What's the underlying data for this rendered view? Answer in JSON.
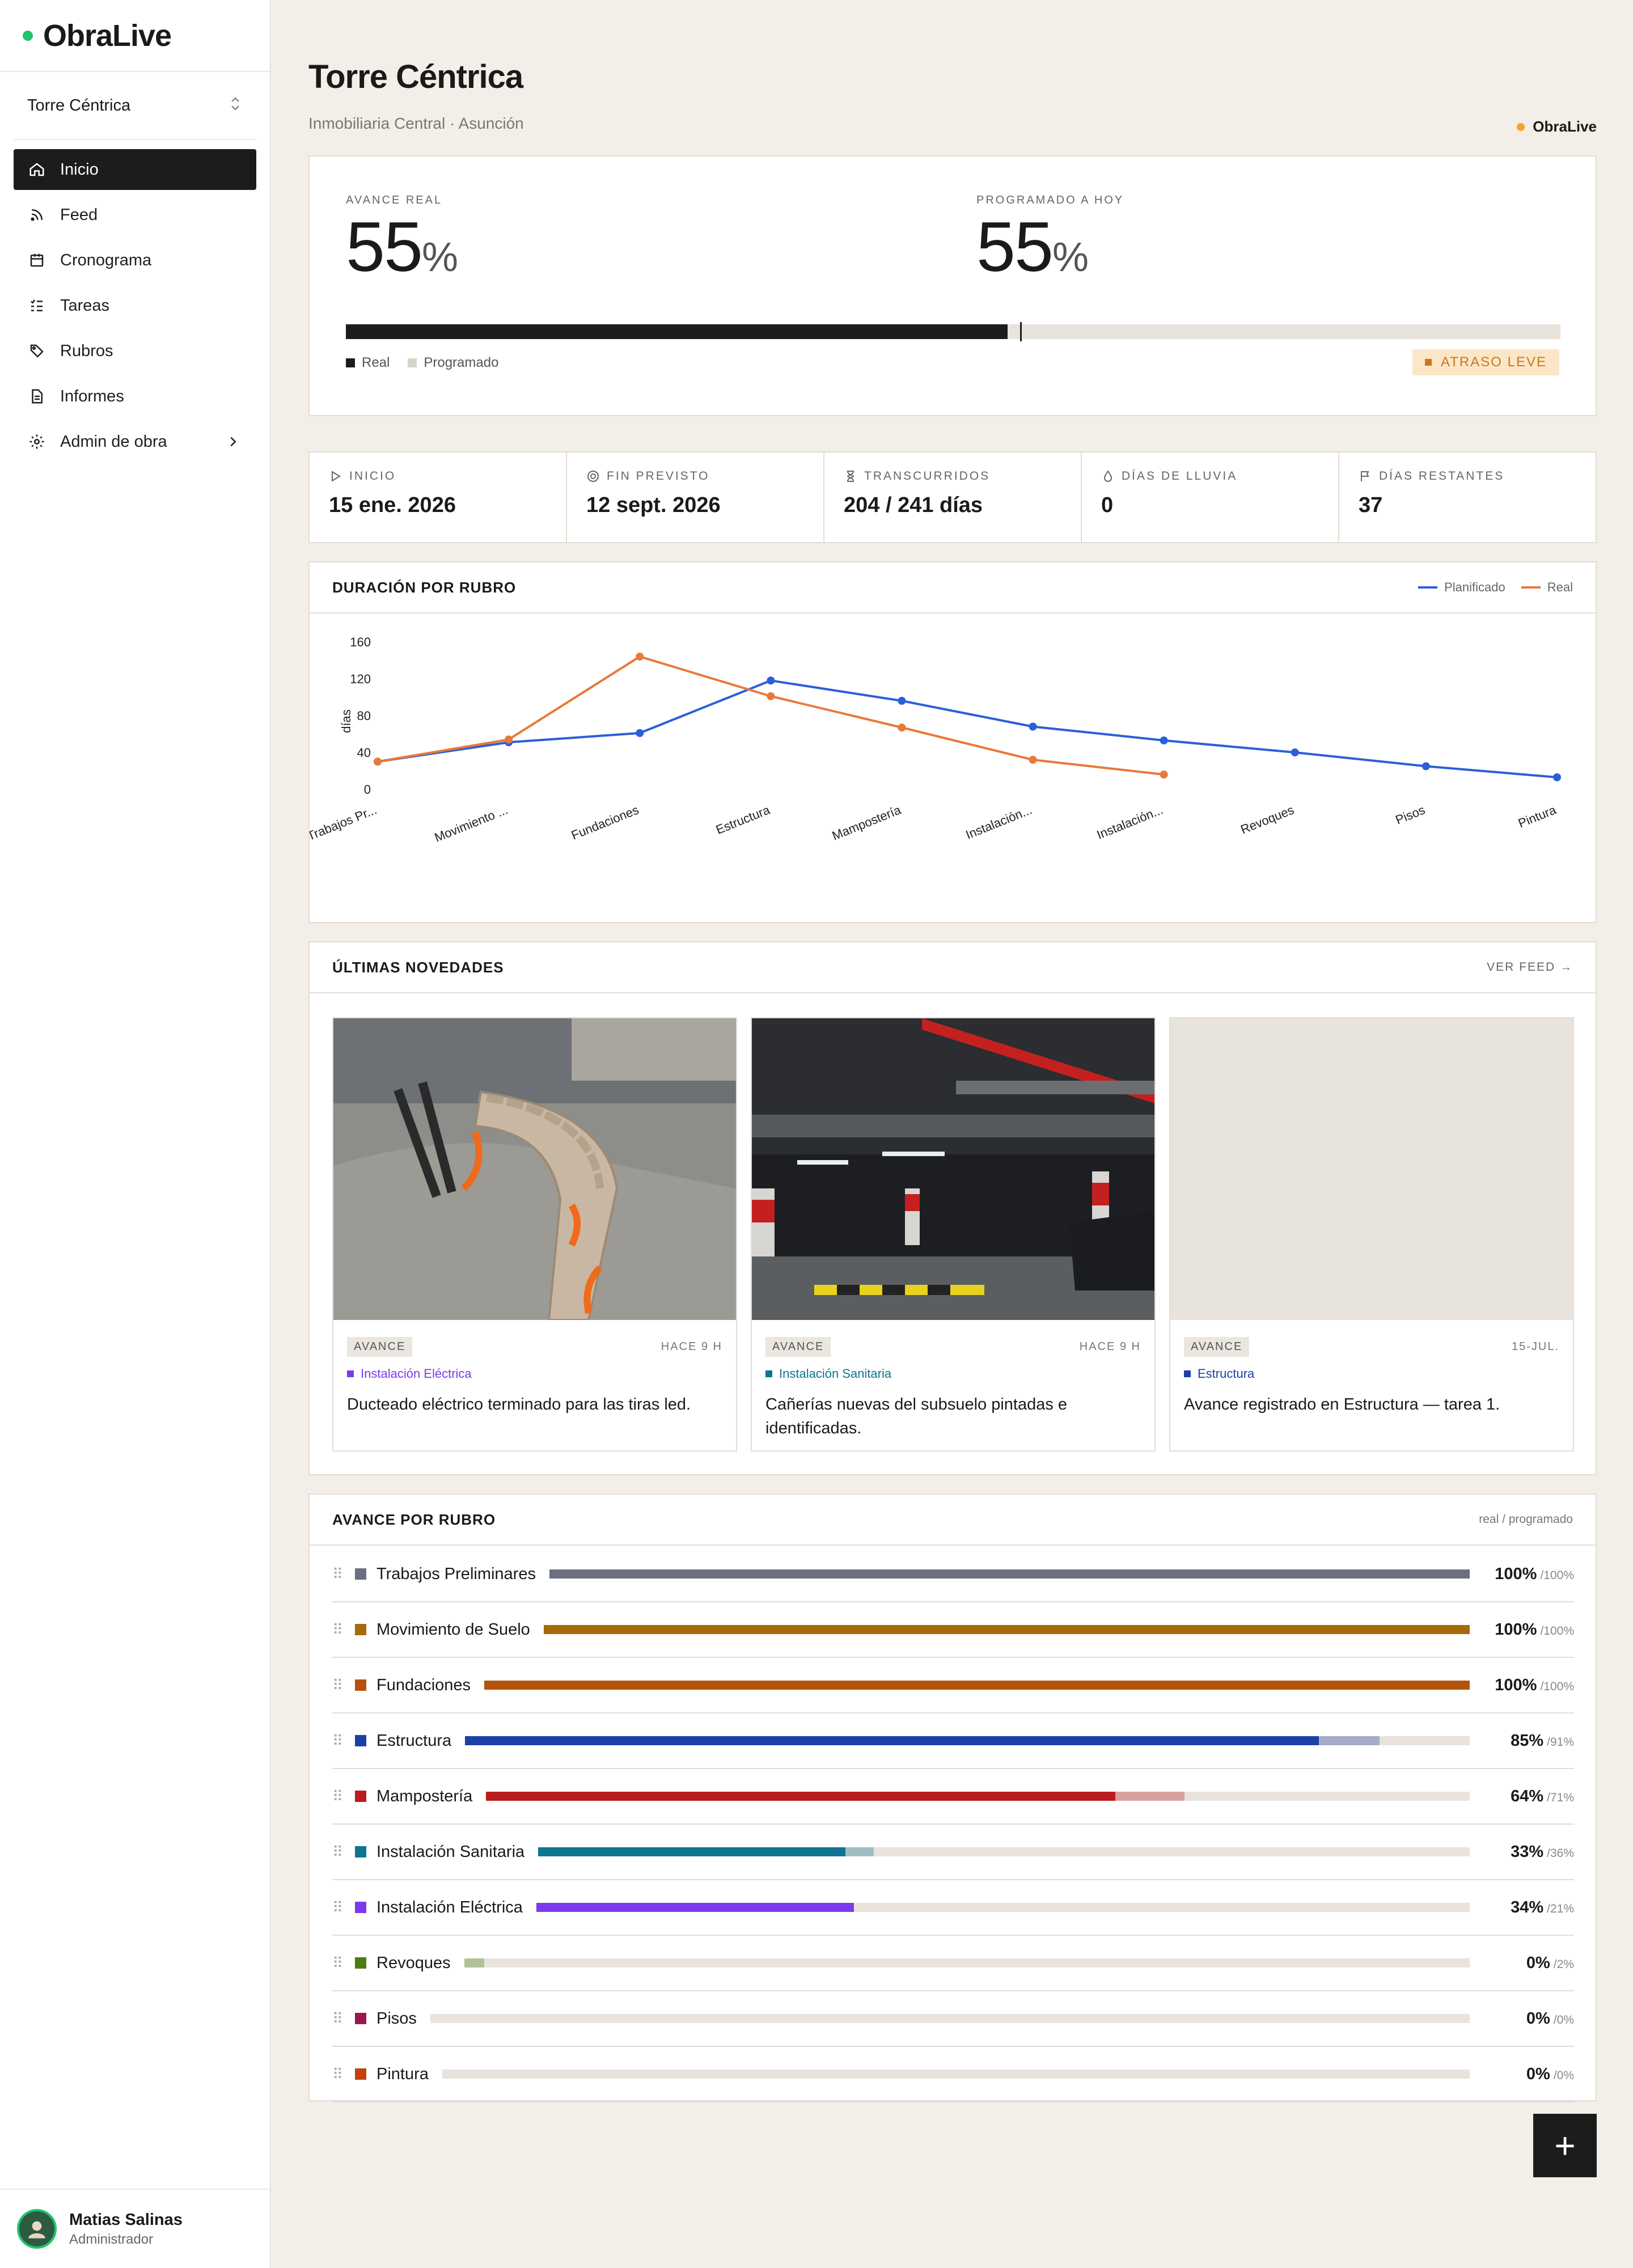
{
  "brand": {
    "name": "ObraLive",
    "dot_color": "#22c56b"
  },
  "sidebar": {
    "project": "Torre Céntrica",
    "items": [
      {
        "label": "Inicio",
        "icon": "home-icon",
        "active": true
      },
      {
        "label": "Feed",
        "icon": "rss-icon"
      },
      {
        "label": "Cronograma",
        "icon": "calendar-icon"
      },
      {
        "label": "Tareas",
        "icon": "tasks-icon"
      },
      {
        "label": "Rubros",
        "icon": "tag-icon"
      },
      {
        "label": "Informes",
        "icon": "document-icon"
      },
      {
        "label": "Admin de obra",
        "icon": "gear-icon",
        "has_chevron": true
      }
    ],
    "user": {
      "name": "Matias Salinas",
      "role": "Administrador"
    }
  },
  "header": {
    "title": "Torre Céntrica",
    "subtitle": "Inmobiliaria Central · Asunción",
    "mini_brand": "ObraLive"
  },
  "progress": {
    "real_label": "AVANCE REAL",
    "real_value": "55",
    "programmed_label": "PROGRAMADO A HOY",
    "programmed_value": "55",
    "percent_sign": "%",
    "real_fraction": 0.545,
    "programmed_fraction": 0.555,
    "legend_real": "Real",
    "legend_programmed": "Programado",
    "status": "ATRASO LEVE",
    "status_color": "#c8791b"
  },
  "stats": [
    {
      "label": "INICIO",
      "value": "15 ene. 2026",
      "icon": "play-icon"
    },
    {
      "label": "FIN PREVISTO",
      "value": "12 sept. 2026",
      "icon": "target-icon"
    },
    {
      "label": "TRANSCURRIDOS",
      "value": "204 / 241 días",
      "icon": "hourglass-icon"
    },
    {
      "label": "DÍAS DE LLUVIA",
      "value": "0",
      "icon": "drop-icon"
    },
    {
      "label": "DÍAS RESTANTES",
      "value": "37",
      "icon": "flag-icon"
    }
  ],
  "chart_card": {
    "title": "DURACIÓN POR RUBRO",
    "legend_planned": "Planificado",
    "legend_real": "Real"
  },
  "chart_data": {
    "type": "line",
    "ylabel": "días",
    "ylim": [
      0,
      160
    ],
    "yticks": [
      0,
      40,
      80,
      120,
      160
    ],
    "categories": [
      "Trabajos Pr...",
      "Movimiento ...",
      "Fundaciones",
      "Estructura",
      "Mampostería",
      "Instalación...",
      "Instalación...",
      "Revoques",
      "Pisos",
      "Pintura"
    ],
    "series": [
      {
        "name": "Planificado",
        "color": "#2b5fd9",
        "values": [
          30,
          51,
          61,
          118,
          96,
          68,
          53,
          40,
          25,
          13
        ]
      },
      {
        "name": "Real",
        "color": "#e8793a",
        "values": [
          30,
          54,
          144,
          101,
          67,
          32,
          16,
          null,
          null,
          null
        ]
      }
    ]
  },
  "feed": {
    "title": "ÚLTIMAS NOVEDADES",
    "link": "VER FEED →",
    "posts": [
      {
        "tag": "AVANCE",
        "time": "HACE 9 H",
        "category": "Instalación Eléctrica",
        "category_color": "#7c3aed",
        "text": "Ducteado eléctrico terminado para las tiras led."
      },
      {
        "tag": "AVANCE",
        "time": "HACE 9 H",
        "category": "Instalación Sanitaria",
        "category_color": "#0e7490",
        "text": "Cañerías nuevas del subsuelo pintadas e identificadas."
      },
      {
        "tag": "AVANCE",
        "time": "15-JUL.",
        "category": "Estructura",
        "category_color": "#1d3fa8",
        "text": "Avance registrado en Estructura — tarea 1."
      }
    ]
  },
  "rubros": {
    "title": "AVANCE POR RUBRO",
    "hint": "real / programado",
    "items": [
      {
        "name": "Trabajos Preliminares",
        "real": 100,
        "prog": 100,
        "real_label": "100%",
        "prog_label": "/100%",
        "color": "#6b6f80"
      },
      {
        "name": "Movimiento de Suelo",
        "real": 100,
        "prog": 100,
        "real_label": "100%",
        "prog_label": "/100%",
        "color": "#a66a08"
      },
      {
        "name": "Fundaciones",
        "real": 100,
        "prog": 100,
        "real_label": "100%",
        "prog_label": "/100%",
        "color": "#b4530b"
      },
      {
        "name": "Estructura",
        "real": 85,
        "prog": 91,
        "real_label": "85%",
        "prog_label": "/91%",
        "color": "#1d3fa8"
      },
      {
        "name": "Mampostería",
        "real": 64,
        "prog": 71,
        "real_label": "64%",
        "prog_label": "/71%",
        "color": "#b91c1c"
      },
      {
        "name": "Instalación Sanitaria",
        "real": 33,
        "prog": 36,
        "real_label": "33%",
        "prog_label": "/36%",
        "color": "#0e7490"
      },
      {
        "name": "Instalación Eléctrica",
        "real": 34,
        "prog": 21,
        "real_label": "34%",
        "prog_label": "/21%",
        "color": "#7c3aed"
      },
      {
        "name": "Revoques",
        "real": 0,
        "prog": 2,
        "real_label": "0%",
        "prog_label": "/2%",
        "color": "#4d7c0f"
      },
      {
        "name": "Pisos",
        "real": 0,
        "prog": 0,
        "real_label": "0%",
        "prog_label": "/0%",
        "color": "#9d174d"
      },
      {
        "name": "Pintura",
        "real": 0,
        "prog": 0,
        "real_label": "0%",
        "prog_label": "/0%",
        "color": "#c2410c"
      }
    ]
  },
  "fab": {
    "label": "+"
  }
}
